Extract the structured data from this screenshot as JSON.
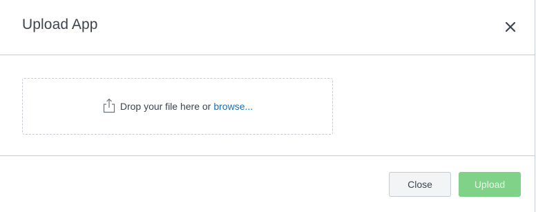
{
  "modal": {
    "title": "Upload App"
  },
  "dropzone": {
    "prompt": "Drop your file here or",
    "browse_label": "browse..."
  },
  "footer": {
    "close_label": "Close",
    "upload_label": "Upload"
  },
  "colors": {
    "link": "#1a6fb5",
    "upload_button_disabled": "#7fd287",
    "border": "#c3cbd4"
  },
  "icons": {
    "close": "close-icon",
    "upload": "upload-icon"
  }
}
